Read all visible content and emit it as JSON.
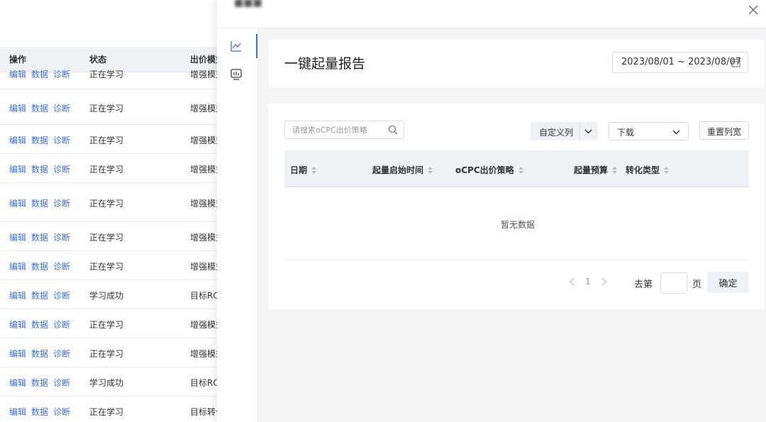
{
  "background_table": {
    "headers": {
      "actions": "操作",
      "status": "状态",
      "mode": "出价模式"
    },
    "rows": [
      {
        "edit": "编辑",
        "data": "数据",
        "diagnose": "诊断",
        "status": "正在学习",
        "mode": "增强模式"
      },
      {
        "edit": "编辑",
        "data": "数据",
        "diagnose": "诊断",
        "status": "正在学习",
        "mode": "增强模式"
      },
      {
        "edit": "编辑",
        "data": "数据",
        "diagnose": "诊断",
        "status": "正在学习",
        "mode": "增强模式"
      },
      {
        "edit": "编辑",
        "data": "数据",
        "diagnose": "诊断",
        "status": "正在学习",
        "mode": "增强模式"
      },
      {
        "edit": "编辑",
        "data": "数据",
        "diagnose": "诊断",
        "status": "正在学习",
        "mode": "增强模式"
      },
      {
        "edit": "编辑",
        "data": "数据",
        "diagnose": "诊断",
        "status": "正在学习",
        "mode": "增强模式"
      },
      {
        "edit": "编辑",
        "data": "数据",
        "diagnose": "诊断",
        "status": "正在学习",
        "mode": "增强模式"
      },
      {
        "edit": "编辑",
        "data": "数据",
        "diagnose": "诊断",
        "status": "学习成功",
        "mode": "目标ROI"
      },
      {
        "edit": "编辑",
        "data": "数据",
        "diagnose": "诊断",
        "status": "正在学习",
        "mode": "增强模式"
      },
      {
        "edit": "编辑",
        "data": "数据",
        "diagnose": "诊断",
        "status": "正在学习",
        "mode": "增强模式"
      },
      {
        "edit": "编辑",
        "data": "数据",
        "diagnose": "诊断",
        "status": "学习成功",
        "mode": "目标ROI"
      },
      {
        "edit": "编辑",
        "data": "数据",
        "diagnose": "诊断",
        "status": "正在学习",
        "mode": "目标转化"
      }
    ]
  },
  "drawer": {
    "title": "■■■",
    "page_title": "一键起量报告",
    "date_range": "2023/08/01 ~ 2023/08/07",
    "search_placeholder": "请搜索oCPC出价策略",
    "custom_columns_label": "自定义列",
    "download_label": "下载",
    "reset_width_label": "重置列宽",
    "columns": {
      "date": "日期",
      "start_time": "起量启始时间",
      "strategy": "oCPC出价策略",
      "budget": "起量预算",
      "conv_type": "转化类型"
    },
    "empty_text": "暂无数据",
    "pagination": {
      "current_page": "1",
      "goto_label": "去第",
      "page_unit": "页",
      "confirm_label": "确定"
    }
  },
  "colors": {
    "accent": "#3a6fd8",
    "header_bg": "#eef1f6",
    "drawer_bg": "#f4f5f7"
  }
}
